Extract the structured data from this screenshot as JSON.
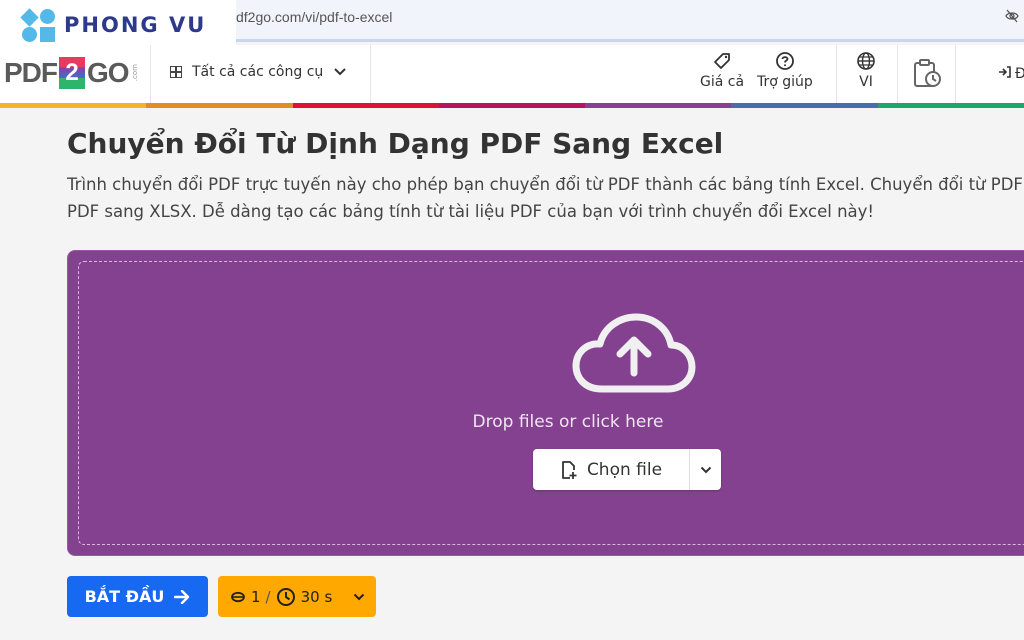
{
  "browser": {
    "url": "df2go.com/vi/pdf-to-excel"
  },
  "watermark": {
    "brand": "PHONG VU"
  },
  "header": {
    "logo_left": "PDF",
    "logo_mid": "2",
    "logo_right": "GO",
    "logo_suffix": ".com",
    "tools_label": "Tất cả các công cụ",
    "nav": {
      "pricing": "Giá cả",
      "help": "Trợ giúp",
      "language": "VI",
      "login": "Đ"
    }
  },
  "stripe_colors": [
    "#f2b52a",
    "#e38a2b",
    "#dc1237",
    "#b8145e",
    "#8a3f94",
    "#446fac",
    "#20a46d"
  ],
  "main": {
    "title": "Chuyển Đổi Từ Dịnh Dạng PDF Sang Excel",
    "description_line1": "Trình chuyển đổi PDF trực tuyến này cho phép bạn chuyển đổi từ PDF thành các bảng tính Excel. Chuyển đổi từ PDF",
    "description_line2": "PDF sang XLSX. Dễ dàng tạo các bảng tính từ tài liệu PDF của bạn với trình chuyển đổi Excel này!"
  },
  "dropzone": {
    "prompt": "Drop files or click here",
    "choose_label": "Chọn file",
    "color": "#84418f"
  },
  "actions": {
    "start_label": "BẮT ĐẦU",
    "credits": "1",
    "separator": "/",
    "time": "30 s"
  }
}
